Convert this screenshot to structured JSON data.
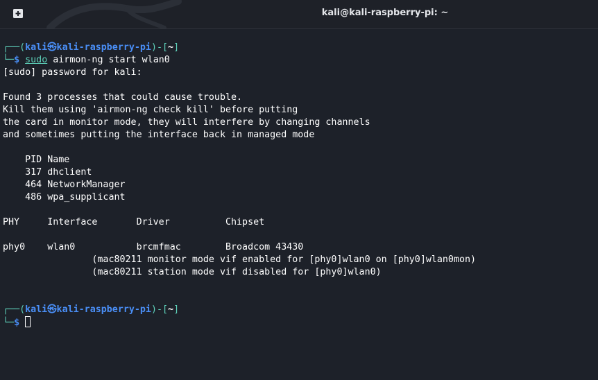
{
  "window": {
    "title": "kali@kali-raspberry-pi: ~"
  },
  "icons": {
    "new_tab": "new-tab-icon",
    "background": "kali-dragon-icon"
  },
  "prompt": {
    "corner_top": "┌──(",
    "user": "kali",
    "at_symbol": "㉿",
    "host": "kali-raspberry-pi",
    "mid": ")-[",
    "path": "~",
    "close": "]",
    "corner_bottom": "└─",
    "dollar": "$"
  },
  "command": {
    "first": "sudo",
    "rest": " airmon-ng start wlan0"
  },
  "output": [
    "[sudo] password for kali:",
    "",
    "Found 3 processes that could cause trouble.",
    "Kill them using 'airmon-ng check kill' before putting",
    "the card in monitor mode, they will interfere by changing channels",
    "and sometimes putting the interface back in managed mode",
    "",
    "    PID Name",
    "    317 dhclient",
    "    464 NetworkManager",
    "    486 wpa_supplicant",
    "",
    "PHY     Interface       Driver          Chipset",
    "",
    "phy0    wlan0           brcmfmac        Broadcom 43430",
    "                (mac80211 monitor mode vif enabled for [phy0]wlan0 on [phy0]wlan0mon)",
    "                (mac80211 station mode vif disabled for [phy0]wlan0)"
  ],
  "colors": {
    "background": "#1d2129",
    "prompt_green": "#5fd3bc",
    "prompt_blue": "#4a8ff7",
    "text": "#ffffff"
  }
}
